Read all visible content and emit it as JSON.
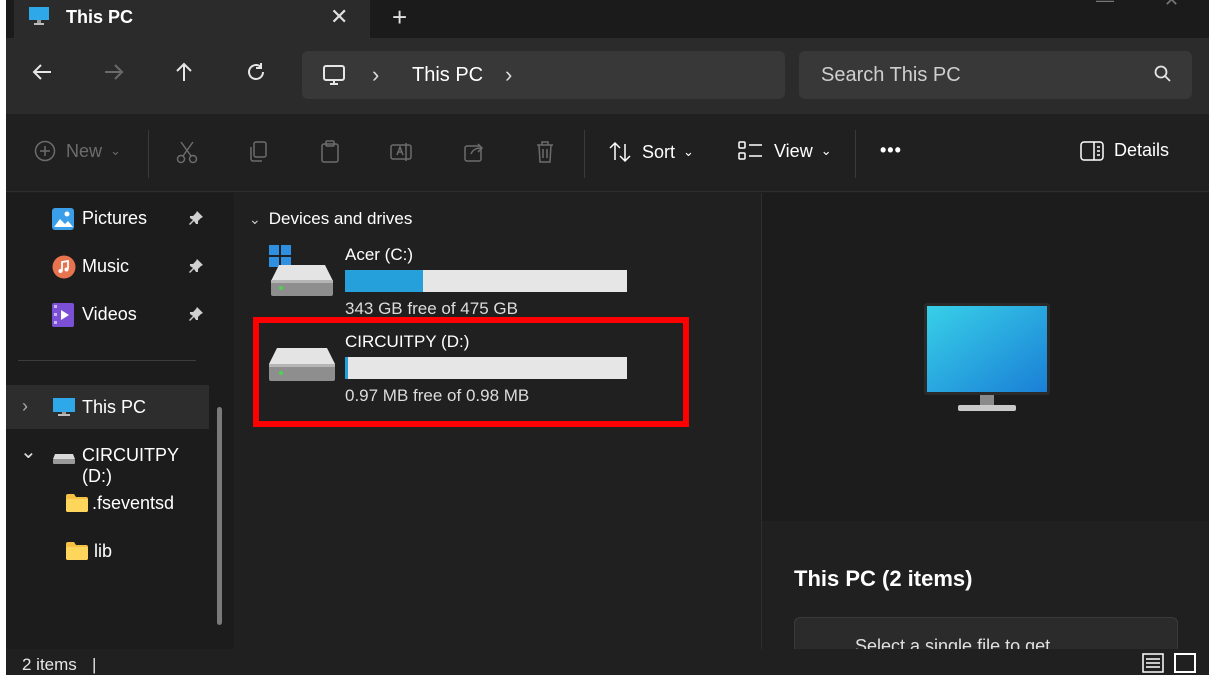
{
  "tab": {
    "title": "This PC",
    "close": "✕",
    "add": "+"
  },
  "address": {
    "breadcrumb": "This PC",
    "separator": "›"
  },
  "search": {
    "placeholder": "Search This PC"
  },
  "commands": {
    "new_label": "New",
    "sort_label": "Sort",
    "view_label": "View",
    "more_label": "•••",
    "details_label": "Details"
  },
  "sidebar": {
    "pinned": [
      {
        "label": "Pictures"
      },
      {
        "label": "Music"
      },
      {
        "label": "Videos"
      }
    ],
    "tree": [
      {
        "label": "This PC",
        "expander": "›"
      },
      {
        "label": "CIRCUITPY (D:)",
        "expander": "⌄"
      },
      {
        "label": ".fseventsd"
      },
      {
        "label": "lib"
      }
    ]
  },
  "content": {
    "group_label": "Devices and drives",
    "drives": [
      {
        "name": "Acer (C:)",
        "free_text": "343 GB free of 475 GB",
        "used_fraction": 0.278
      },
      {
        "name": "CIRCUITPY (D:)",
        "free_text": "0.97 MB free of 0.98 MB",
        "used_fraction": 0.01
      }
    ]
  },
  "details": {
    "title": "This PC (2 items)",
    "card_text": "Select a single file to get"
  },
  "status": {
    "count": "2 items",
    "divider": "|"
  },
  "colors": {
    "accent": "#26a0da",
    "highlight": "#ff0000",
    "window_bg": "#202020"
  }
}
